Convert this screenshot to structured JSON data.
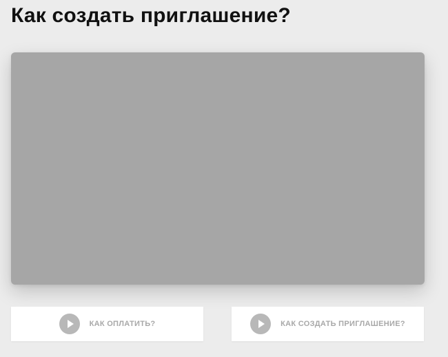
{
  "page": {
    "title": "Как создать приглашение?"
  },
  "video": {
    "background_color": "#a6a6a6"
  },
  "video_buttons": [
    {
      "label": "КАК ОПЛАТИТЬ?",
      "icon": "play-icon"
    },
    {
      "label": "КАК СОЗДАТЬ ПРИГЛАШЕНИЕ?",
      "icon": "play-icon"
    }
  ],
  "colors": {
    "page_background": "#ececec",
    "button_background": "#ffffff",
    "button_text": "#a8a8a8",
    "icon_background": "#b8b8b8"
  }
}
